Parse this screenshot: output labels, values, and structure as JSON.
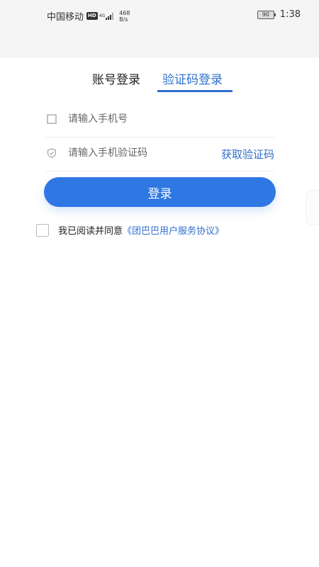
{
  "status_bar": {
    "carrier": "中国移动",
    "hd_badge": "HD",
    "network_type": "4G",
    "speed_value": "468",
    "speed_unit": "B/s",
    "battery_level": "90",
    "time": "1:38"
  },
  "tabs": [
    {
      "label": "账号登录",
      "active": false
    },
    {
      "label": "验证码登录",
      "active": true
    }
  ],
  "form": {
    "phone_placeholder": "请输入手机号",
    "code_placeholder": "请输入手机验证码",
    "get_code_label": "获取验证码",
    "login_label": "登录"
  },
  "agreement": {
    "text": "我已阅读并同意",
    "link": "《团巴巴用户服务协议》",
    "checked": false
  },
  "colors": {
    "accent": "#2f6fcf",
    "button": "#2f77e3",
    "status_bg": "#f5f5f5"
  }
}
